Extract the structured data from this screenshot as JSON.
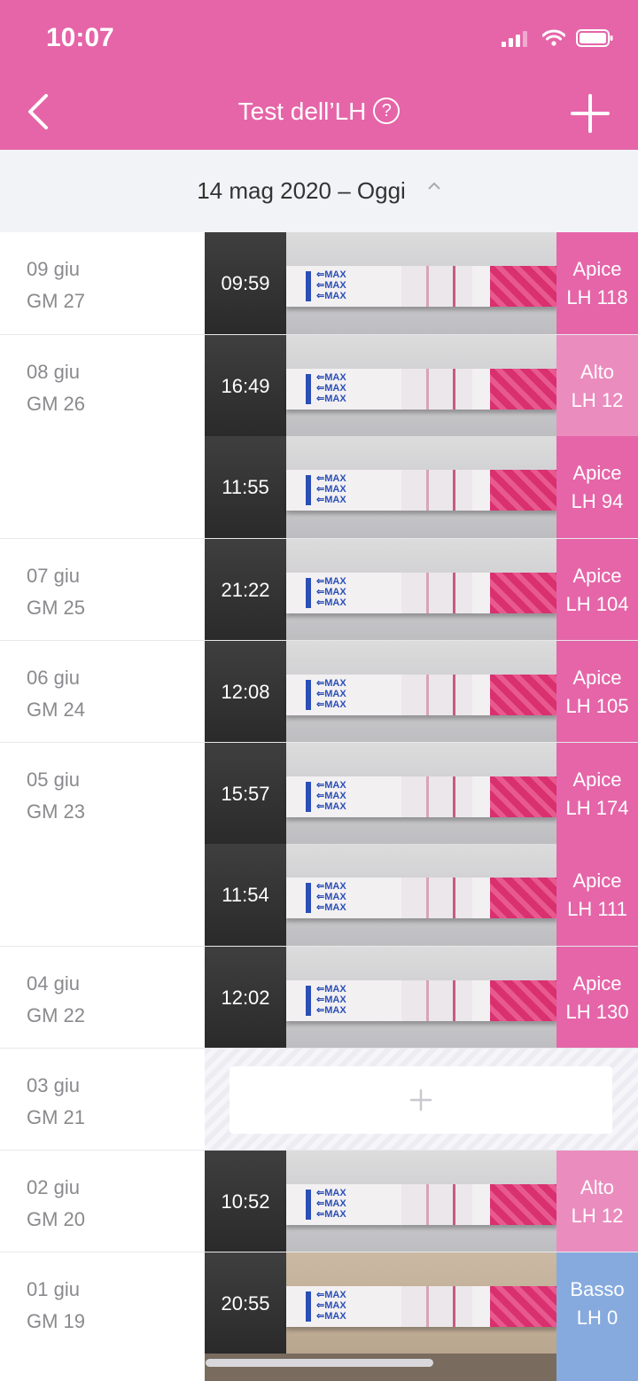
{
  "status_bar": {
    "time": "10:07"
  },
  "header": {
    "title": "Test dell’LH",
    "help_symbol": "?",
    "accent": "#e565a8"
  },
  "range": {
    "label": "14 mag 2020 – Oggi"
  },
  "colors": {
    "apice": "#e565a8",
    "alto": "#eb8cbe",
    "basso": "#86aade"
  },
  "rows": [
    {
      "date": "09 giu",
      "cycle_day": "GM 27",
      "time": "09:59",
      "level": "Apice",
      "value": "LH 118"
    },
    {
      "date": "08 giu",
      "cycle_day": "GM 26",
      "time": "16:49",
      "level": "Alto",
      "value": "LH 12"
    },
    {
      "date": "",
      "cycle_day": "",
      "time": "11:55",
      "level": "Apice",
      "value": "LH 94"
    },
    {
      "date": "07 giu",
      "cycle_day": "GM 25",
      "time": "21:22",
      "level": "Apice",
      "value": "LH 104"
    },
    {
      "date": "06 giu",
      "cycle_day": "GM 24",
      "time": "12:08",
      "level": "Apice",
      "value": "LH 105"
    },
    {
      "date": "05 giu",
      "cycle_day": "GM 23",
      "time": "15:57",
      "level": "Apice",
      "value": "LH 174"
    },
    {
      "date": "",
      "cycle_day": "",
      "time": "11:54",
      "level": "Apice",
      "value": "LH 111"
    },
    {
      "date": "04 giu",
      "cycle_day": "GM 22",
      "time": "12:02",
      "level": "Apice",
      "value": "LH 130"
    },
    {
      "date": "03 giu",
      "cycle_day": "GM 21"
    },
    {
      "date": "02 giu",
      "cycle_day": "GM 20",
      "time": "10:52",
      "level": "Alto",
      "value": "LH 12"
    },
    {
      "date": "01 giu",
      "cycle_day": "GM 19",
      "time": "20:55",
      "level": "Basso",
      "value": "LH 0"
    }
  ]
}
